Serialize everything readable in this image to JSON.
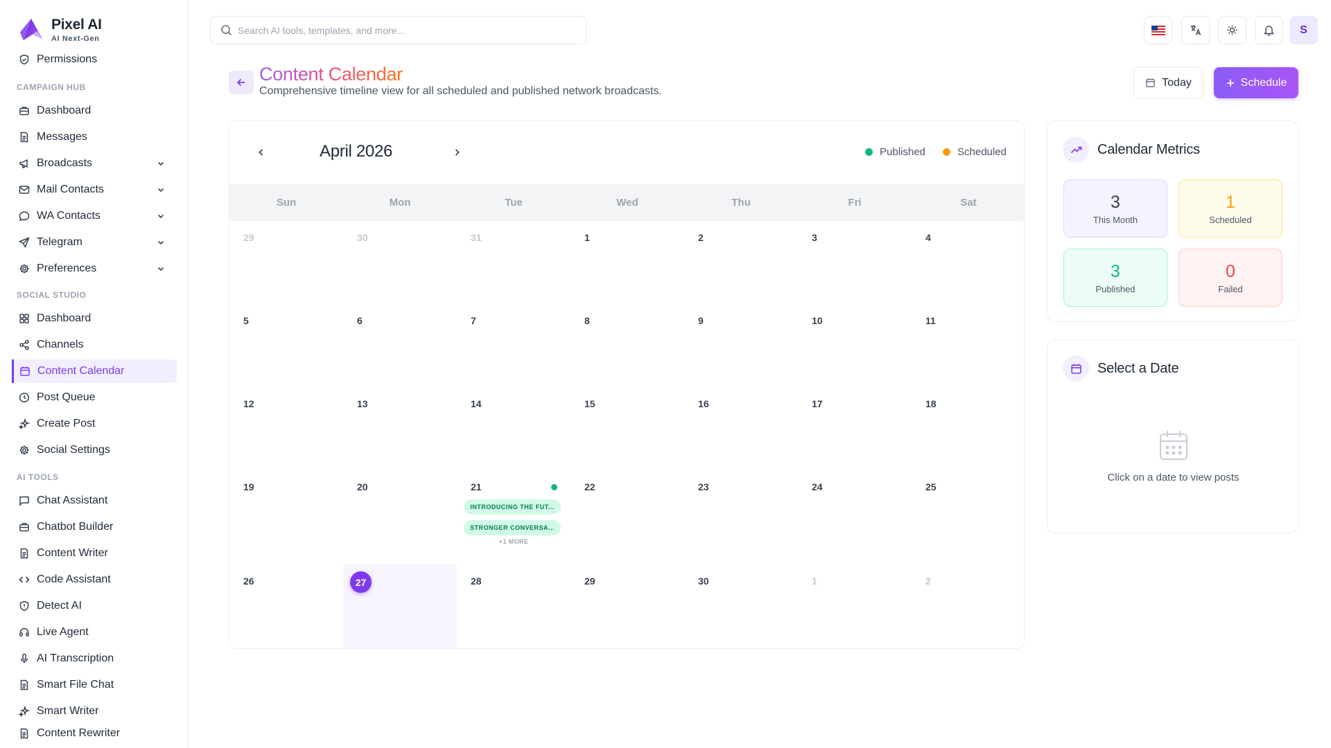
{
  "brand": {
    "name": "Pixel AI",
    "tagline": "AI Next-Gen"
  },
  "sidebar": {
    "permissions": "Permissions",
    "sections": {
      "campaign": "CAMPAIGN HUB",
      "social": "SOCIAL STUDIO",
      "ai": "AI TOOLS"
    },
    "campaign_items": [
      "Dashboard",
      "Messages",
      "Broadcasts",
      "Mail Contacts",
      "WA Contacts",
      "Telegram",
      "Preferences"
    ],
    "social_items": [
      "Dashboard",
      "Channels",
      "Content Calendar",
      "Post Queue",
      "Create Post",
      "Social Settings"
    ],
    "ai_items": [
      "Chat Assistant",
      "Chatbot Builder",
      "Content Writer",
      "Code Assistant",
      "Detect AI",
      "Live Agent",
      "AI Transcription",
      "Smart File Chat",
      "Smart Writer",
      "Content Rewriter"
    ]
  },
  "search": {
    "placeholder": "Search AI tools, templates, and more..."
  },
  "user": {
    "initial": "S"
  },
  "header": {
    "title": "Content Calendar",
    "subtitle": "Comprehensive timeline view for all scheduled and published network broadcasts.",
    "today_label": "Today",
    "schedule_label": "Schedule"
  },
  "calendar": {
    "month_label": "April 2026",
    "legend": {
      "published": "Published",
      "scheduled": "Scheduled"
    },
    "weekdays": [
      "Sun",
      "Mon",
      "Tue",
      "Wed",
      "Thu",
      "Fri",
      "Sat"
    ],
    "weeks": [
      [
        "29",
        "30",
        "31",
        "1",
        "2",
        "3",
        "4"
      ],
      [
        "5",
        "6",
        "7",
        "8",
        "9",
        "10",
        "11"
      ],
      [
        "12",
        "13",
        "14",
        "15",
        "16",
        "17",
        "18"
      ],
      [
        "19",
        "20",
        "21",
        "22",
        "23",
        "24",
        "25"
      ],
      [
        "26",
        "27",
        "28",
        "29",
        "30",
        "1",
        "2"
      ]
    ],
    "events": [
      "INTRODUCING THE FUT...",
      "STRONGER CONVERSA..."
    ],
    "more_label": "+1 MORE"
  },
  "metrics": {
    "title": "Calendar Metrics",
    "items": [
      {
        "value": "3",
        "label": "This Month"
      },
      {
        "value": "1",
        "label": "Scheduled"
      },
      {
        "value": "3",
        "label": "Published"
      },
      {
        "value": "0",
        "label": "Failed"
      }
    ]
  },
  "select_date": {
    "title": "Select a Date",
    "empty_text": "Click on a date to view posts"
  },
  "colors": {
    "accent": "#7c3aed",
    "published": "#10b981",
    "scheduled": "#f59e0b",
    "failed": "#ef4444"
  }
}
